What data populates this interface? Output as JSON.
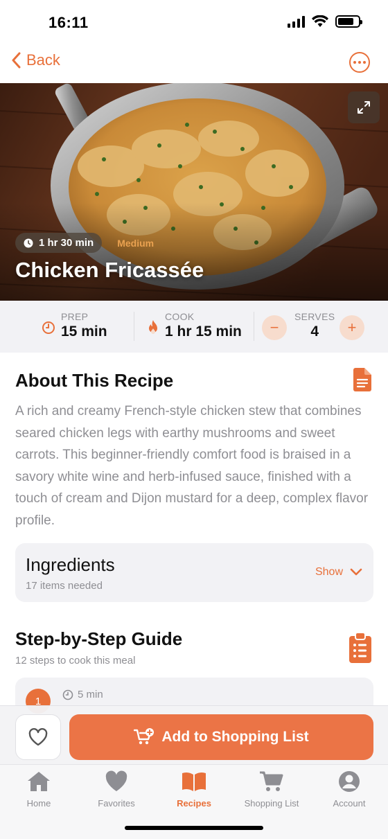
{
  "status_bar": {
    "time": "16:11",
    "signal_icon": "cellular-signal-icon",
    "wifi_icon": "wifi-icon",
    "battery_icon": "battery-icon",
    "battery_level": 0.8
  },
  "nav": {
    "back_label": "Back",
    "back_icon": "chevron-left-icon",
    "more_icon": "ellipsis-circle-icon"
  },
  "hero": {
    "expand_icon": "expand-arrows-icon",
    "time_chip": "1 hr 30 min",
    "time_icon": "clock-icon",
    "difficulty": "Medium",
    "title": "Chicken Fricassée"
  },
  "stats": {
    "prep_label": "PREP",
    "prep_value": "15 min",
    "cook_label": "COOK",
    "cook_value": "1 hr 15 min",
    "serves_label": "SERVES",
    "serves_value": "4",
    "minus_label": "−",
    "plus_label": "+"
  },
  "about": {
    "title": "About This Recipe",
    "icon": "document-icon",
    "text": "A rich and creamy French-style chicken stew that combines seared chicken legs with earthy mushrooms and sweet carrots. This beginner-friendly comfort food is braised in a savory white wine and herb-infused sauce, finished with a touch of cream and Dijon mustard for a deep, complex flavor profile."
  },
  "ingredients": {
    "title": "Ingredients",
    "subtitle": "17 items needed",
    "show_label": "Show",
    "show_icon": "chevron-down-icon"
  },
  "guide": {
    "title": "Step-by-Step Guide",
    "subtitle": "12 steps to cook this meal",
    "icon": "clipboard-list-icon",
    "first_step": {
      "number": "1",
      "time": "5 min"
    }
  },
  "actions": {
    "favorite_icon": "heart-outline-icon",
    "add_label": "Add to Shopping List",
    "add_icon": "cart-plus-icon"
  },
  "tabs": [
    {
      "label": "Home",
      "icon": "home-icon",
      "active": false
    },
    {
      "label": "Favorites",
      "icon": "heart-icon",
      "active": false
    },
    {
      "label": "Recipes",
      "icon": "book-open-icon",
      "active": true
    },
    {
      "label": "Shopping List",
      "icon": "cart-icon",
      "active": false
    },
    {
      "label": "Account",
      "icon": "person-circle-icon",
      "active": false
    }
  ],
  "colors": {
    "accent": "#E8703A",
    "button": "#EB7446",
    "muted": "#8E8E93",
    "card": "#F2F2F5"
  }
}
